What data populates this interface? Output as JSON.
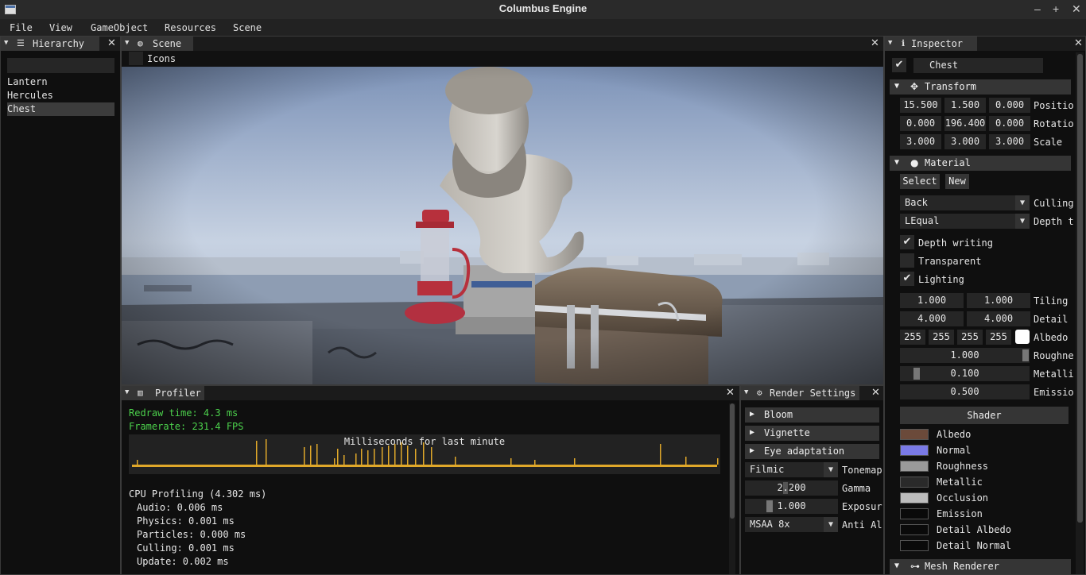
{
  "window": {
    "title": "Columbus Engine"
  },
  "menu": [
    "File",
    "View",
    "GameObject",
    "Resources",
    "Scene"
  ],
  "hierarchy": {
    "tab": "Hierarchy",
    "search_value": "",
    "items": [
      "Lantern",
      "Hercules",
      "Chest"
    ],
    "selected": "Chest"
  },
  "scene": {
    "tab": "Scene",
    "icons_label": "Icons"
  },
  "profiler": {
    "tab": "Profiler",
    "redraw": "Redraw time: 4.3 ms",
    "framerate": "Framerate:   231.4 FPS",
    "graph_title": "Milliseconds for last minute",
    "cpu_header": "CPU Profiling (4.302 ms)",
    "rows": [
      "Audio:     0.006 ms",
      "Physics:   0.001 ms",
      "Particles: 0.000 ms",
      "Culling:   0.001 ms",
      "Update:    0.002 ms"
    ],
    "graph_color": "#e0a82a"
  },
  "render_settings": {
    "tab": "Render Settings",
    "sections": [
      "Bloom",
      "Vignette",
      "Eye adaptation"
    ],
    "tonemap_value": "Filmic",
    "tonemap_label": "Tonemap",
    "gamma_value": "2.200",
    "gamma_label": "Gamma",
    "exposure_value": "1.000",
    "exposure_label": "Exposur",
    "aa_value": "MSAA 8x",
    "aa_label": "Anti Al"
  },
  "inspector": {
    "tab": "Inspector",
    "object_name": "Chest",
    "transform": {
      "header": "Transform",
      "position": [
        "15.500",
        "1.500",
        "0.000"
      ],
      "position_label": "Positio",
      "rotation": [
        "0.000",
        "196.400",
        "0.000"
      ],
      "rotation_label": "Rotatio",
      "scale": [
        "3.000",
        "3.000",
        "3.000"
      ],
      "scale_label": "Scale"
    },
    "material": {
      "header": "Material",
      "select_label": "Select",
      "new_label": "New",
      "culling_value": "Back",
      "culling_label": "Culling",
      "depth_value": "LEqual",
      "depth_label": "Depth t",
      "depth_writing": "Depth writing",
      "transparent": "Transparent",
      "lighting": "Lighting",
      "tiling": [
        "1.000",
        "1.000"
      ],
      "tiling_label": "Tiling",
      "detail": [
        "4.000",
        "4.000"
      ],
      "detail_label": "Detail",
      "albedo": [
        "255",
        "255",
        "255",
        "255"
      ],
      "albedo_label": "Albedo",
      "roughness_value": "1.000",
      "roughness_label": "Roughne",
      "metallic_value": "0.100",
      "metallic_label": "Metalli",
      "emission_value": "0.500",
      "emission_label": "Emissio",
      "shader_label": "Shader",
      "textures": [
        "Albedo",
        "Normal",
        "Roughness",
        "Metallic",
        "Occlusion",
        "Emission",
        "Detail Albedo",
        "Detail Normal"
      ]
    },
    "mesh_renderer": "Mesh Renderer"
  }
}
